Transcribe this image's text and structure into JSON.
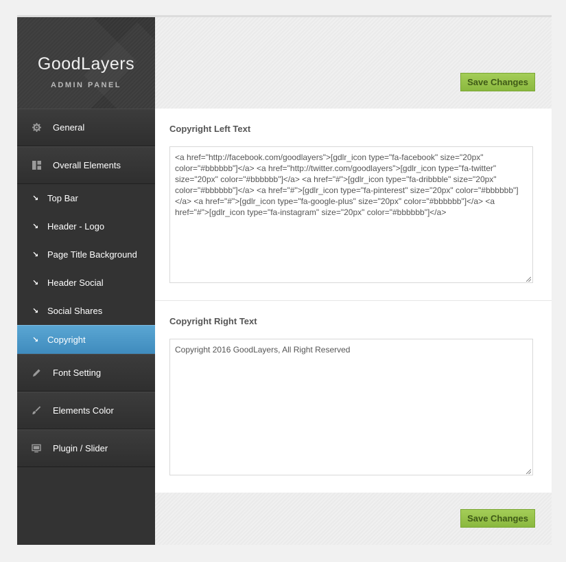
{
  "brand": {
    "title": "GoodLayers",
    "subtitle": "ADMIN PANEL"
  },
  "menu": [
    {
      "label": "General",
      "icon": "gear-icon"
    },
    {
      "label": "Overall Elements",
      "icon": "layout-icon"
    }
  ],
  "submenu": [
    {
      "label": "Top Bar"
    },
    {
      "label": "Header - Logo"
    },
    {
      "label": "Page Title Background"
    },
    {
      "label": "Header Social"
    },
    {
      "label": "Social Shares"
    },
    {
      "label": "Copyright",
      "active": true
    }
  ],
  "menu_after": [
    {
      "label": "Font Setting",
      "icon": "pencil-icon"
    },
    {
      "label": "Elements Color",
      "icon": "brush-icon"
    },
    {
      "label": "Plugin / Slider",
      "icon": "monitor-icon"
    }
  ],
  "buttons": {
    "save_top": "Save Changes",
    "save_bottom": "Save Changes"
  },
  "sections": {
    "left": {
      "title": "Copyright Left Text",
      "value": "<a href=\"http://facebook.com/goodlayers\">[gdlr_icon type=\"fa-facebook\" size=\"20px\" color=\"#bbbbbb\"]</a> <a href=\"http://twitter.com/goodlayers\">[gdlr_icon type=\"fa-twitter\" size=\"20px\" color=\"#bbbbbb\"]</a> <a href=\"#\">[gdlr_icon type=\"fa-dribbble\" size=\"20px\" color=\"#bbbbbb\"]</a> <a href=\"#\">[gdlr_icon type=\"fa-pinterest\" size=\"20px\" color=\"#bbbbbb\"]</a> <a href=\"#\">[gdlr_icon type=\"fa-google-plus\" size=\"20px\" color=\"#bbbbbb\"]</a> <a href=\"#\">[gdlr_icon type=\"fa-instagram\" size=\"20px\" color=\"#bbbbbb\"]</a>"
    },
    "right": {
      "title": "Copyright Right Text",
      "value": "Copyright 2016 GoodLayers, All Right Reserved"
    }
  },
  "colors": {
    "active_item": "#4a9bcc",
    "save_button": "#9bc44e",
    "sidebar": "#333333"
  }
}
